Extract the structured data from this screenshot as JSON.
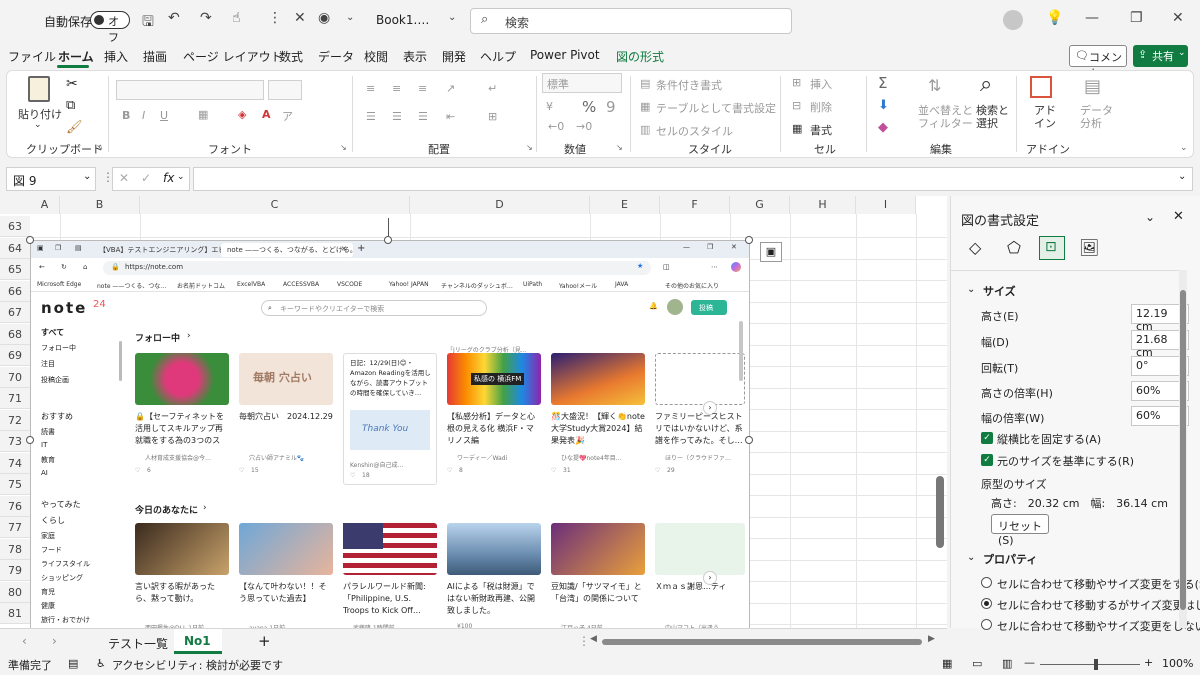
{
  "titlebar": {
    "autosave_label": "自動保存",
    "autosave_state": "オフ",
    "filename": "Book1.…",
    "search_placeholder": "検索"
  },
  "menu": {
    "items": [
      "ファイル",
      "ホーム",
      "挿入",
      "描画",
      "ページ レイアウト",
      "数式",
      "データ",
      "校閲",
      "表示",
      "開発",
      "ヘルプ",
      "Power Pivot",
      "図の形式"
    ],
    "comment": "コメント",
    "share": "共有"
  },
  "ribbon": {
    "clipboard": {
      "paste": "貼り付け",
      "label": "クリップボード"
    },
    "font": {
      "label": "フォント"
    },
    "alignment": {
      "label": "配置"
    },
    "number": {
      "format": "標準",
      "label": "数値"
    },
    "style": {
      "conditional": "条件付き書式",
      "table": "テーブルとして書式設定",
      "cell": "セルのスタイル",
      "label": "スタイル"
    },
    "cells": {
      "insert": "挿入",
      "delete": "削除",
      "format": "書式",
      "label": "セル"
    },
    "edit": {
      "sort": "並べ替えと\nフィルター",
      "find": "検索と\n選択",
      "label": "編集"
    },
    "addin": {
      "addin": "アド\nイン",
      "analyze": "データ\n分析",
      "label": "アドイン"
    }
  },
  "formula": {
    "namebox": "図 9"
  },
  "grid": {
    "columns": [
      "A",
      "B",
      "C",
      "D",
      "E",
      "F",
      "G",
      "H",
      "I"
    ],
    "rows": [
      "63",
      "64",
      "65",
      "66",
      "67",
      "68",
      "69",
      "70",
      "71",
      "72",
      "73",
      "74",
      "75",
      "76",
      "77",
      "78",
      "79",
      "80",
      "81"
    ]
  },
  "browser": {
    "tab1": "【VBA】テストエンジニアリング】エビ",
    "tab2": "note ——つくる、つながる、とどける。",
    "url": "https://note.com",
    "bookmarks": [
      "Microsoft Edge",
      "note ——つくる、つな…",
      "お名前ドットコム",
      "ExcelVBA",
      "ACCESSVBA",
      "VSCODE",
      "Yahoo! JAPAN",
      "チャンネルのダッシュボ…",
      "UiPath",
      "Yahoo!メール",
      "JAVA",
      "その他のお気に入り"
    ],
    "logo": "note",
    "search_placeholder": "キーワードやクリエイターで検索",
    "post": "投稿",
    "nav": [
      "すべて",
      "フォロー中",
      "注目",
      "投稿企画",
      "おすすめ",
      "読書",
      "IT",
      "教育",
      "AI",
      "やってみた",
      "くらし",
      "家庭",
      "フード",
      "ライフスタイル",
      "ショッピング",
      "育児",
      "健康",
      "旅行・おでかけ"
    ],
    "section1": "フォロー中",
    "section2": "今日のあなたに",
    "cards1": [
      {
        "title": "🔒【セーフティネットを活用してスキルアップ再就職をする為の3つのステ…",
        "author": "人材育成支援協会@今…",
        "likes": "6"
      },
      {
        "title": "毎朝穴占い　2024.12.29",
        "author": "穴占い師アナミル🐾",
        "likes": "15"
      },
      {
        "title": "日記：12/29(日)😊・Amazon Readingを活用しながら、読書アウトプットの時間を確保していき…",
        "author": "Kenshin@自己成…",
        "likes": "18"
      },
      {
        "title": "【私感分析】データと心根の見える化 横浜F・マリノス編",
        "author": "ワーディー／Wadi",
        "likes": "8"
      },
      {
        "title": "🎊大盛況！【輝く👏note大学Study大賞2024】結果発表🎉",
        "author": "ひな提💖note4年目…",
        "likes": "31"
      },
      {
        "title": "ファミリーピースヒストリではいかないけど、系譜を作ってみた。そし…",
        "author": "ほりー（クラウドファ…",
        "likes": "29"
      }
    ],
    "thumb1_text": "毎朝 穴占い",
    "thumb3_text": "Thank You",
    "thumb4_text": "私感の 横浜FM",
    "card4_caption": "「Jリーグのクラブ分析（見…",
    "cards2": [
      {
        "title": "言い訳する暇があったら、黙って動け。",
        "author": "西田楓生@DLL 1日前"
      },
      {
        "title": "【なんて叶わない！！そう思っていた過去】",
        "author": "ayana 1日前"
      },
      {
        "title": "パラレルワールド新聞: 「Philippine, U.S. Troops to Kick Off…",
        "author": "武藤隆 1時間前"
      },
      {
        "title": "AIによる「税は財源」ではない新財政再建、公開致しました。",
        "author": "¥100"
      },
      {
        "title": "豆知識/「サツマイモ」と「台湾」の関係について",
        "author": "江戸っ子 4日前"
      },
      {
        "title": "Ｘｍａｓ謝恩…ティ",
        "author": "中山マコト（出逢う…"
      }
    ]
  },
  "pane": {
    "title": "図の書式設定",
    "size_section": "サイズ",
    "height_label": "高さ(E)",
    "height_value": "12.19 cm",
    "width_label": "幅(D)",
    "width_value": "21.68 cm",
    "rotation_label": "回転(T)",
    "rotation_value": "0°",
    "hscale_label": "高さの倍率(H)",
    "hscale_value": "60%",
    "wscale_label": "幅の倍率(W)",
    "wscale_value": "60%",
    "lock_aspect": "縦横比を固定する(A)",
    "relative_original": "元のサイズを基準にする(R)",
    "original_size_label": "原型のサイズ",
    "original_size_value": "高さ:　20.32 cm　幅:　36.14 cm",
    "reset": "リセット(S)",
    "prop_section": "プロパティ",
    "prop1": "セルに合わせて移動やサイズ変更をする(S)",
    "prop2": "セルに合わせて移動するがサイズ変更はしな",
    "prop3": "セルに合わせて移動やサイズ変更をしない"
  },
  "sheets": {
    "tab1": "テスト一覧",
    "tab2": "No1",
    "add": "+"
  },
  "status": {
    "ready": "準備完了",
    "accessibility": "アクセシビリティ: 検討が必要です",
    "zoom": "100%"
  },
  "colors": {
    "accent": "#107c41"
  }
}
